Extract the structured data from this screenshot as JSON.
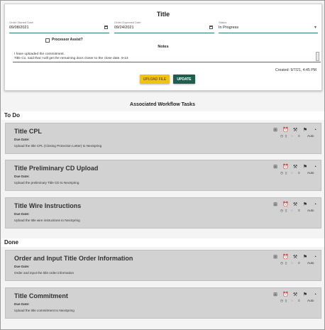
{
  "form": {
    "title": "Title",
    "order_started_date": {
      "label": "Order Started Date",
      "value": "09/08/2021"
    },
    "order_expected_date": {
      "label": "Order Expected Date",
      "value": "09/24/2021"
    },
    "status": {
      "label": "Status",
      "value": "In Progress"
    },
    "processor_assist_label": "Processor Assist?",
    "notes_label": "Notes",
    "notes_text": "I have uploaded the commitment.\nTitle Co. said that I will get the remaining docs closer to the close date. 9-13",
    "created": "Created: 9/7/21, 4:45 PM",
    "upload_button": "UPLOAD FILE",
    "update_button": "UPDATE"
  },
  "workflow": {
    "title": "Associated Workflow Tasks",
    "groups": [
      {
        "label": "To Do",
        "tasks": [
          {
            "title": "Title CPL",
            "due_label": "Due Date:",
            "description": "Upload the title CPL (Closing Protection Letter) to NexSpring",
            "mode": "Auto"
          },
          {
            "title": "Title Preliminary CD Upload",
            "due_label": "Due Date:",
            "description": "Upload the preliminary Title CD to NexSpring",
            "mode": "Auto"
          },
          {
            "title": "Title Wire Instructions",
            "due_label": "Due Date:",
            "description": "Upload the title wire instructions to NexSpring",
            "mode": "Auto"
          }
        ]
      },
      {
        "label": "Done",
        "tasks": [
          {
            "title": "Order and Input Title Order Information",
            "due_label": "Due Date:",
            "description": "Order and input the title order information",
            "mode": "Auto"
          },
          {
            "title": "Title Commitment",
            "due_label": "Due Date:",
            "description": "Upload the title commitment to NexSpring",
            "mode": "Auto"
          }
        ]
      }
    ]
  },
  "task_icons": {
    "top": [
      "sitemap-icon",
      "alarm-clock-icon",
      "gavel-icon",
      "flag-icon",
      "gauge-icon"
    ],
    "bottom": [
      "clock-icon",
      "document-icon",
      "comment-icon",
      "list-icon"
    ]
  },
  "colors": {
    "accent": "#1c5e50",
    "upload_button": "#f2c20f",
    "task_background": "#d2d2d2"
  }
}
